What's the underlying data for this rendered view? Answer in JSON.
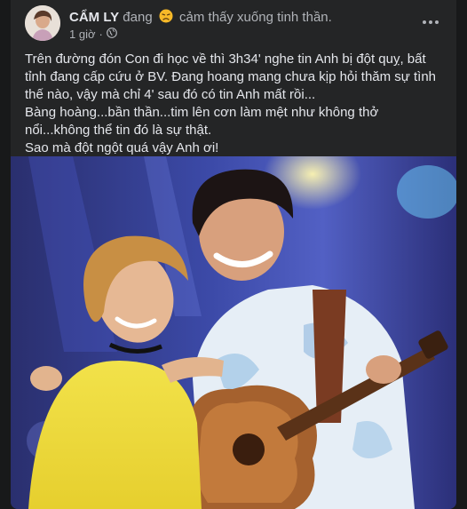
{
  "post": {
    "author": "CẨM LY",
    "status_prefix": "đang",
    "feeling_text": "cảm thấy xuống tinh thần.",
    "feeling_icon": "sad-face-emoji",
    "timestamp": "1 giờ",
    "audience_icon": "globe-icon",
    "body_lines": [
      "Trên đường đón Con đi học về thì 3h34' nghe tin Anh bị đột quỵ, bất tỉnh đang cấp cứu ở BV. Đang hoang mang chưa kịp hỏi thăm sự tình thế nào, vậy mà chỉ 4' sau đó có tin Anh mất rồi...",
      "Bàng hoàng...bần thần...tim lên cơn làm mệt như không thở nổi...không thể tin đó là sự thật.",
      "Sao mà đột ngột quá vậy Anh ơi!"
    ]
  },
  "colors": {
    "card_bg": "#242526",
    "page_bg": "#18191a",
    "primary_text": "#e4e6eb",
    "secondary_text": "#b0b3b8"
  }
}
